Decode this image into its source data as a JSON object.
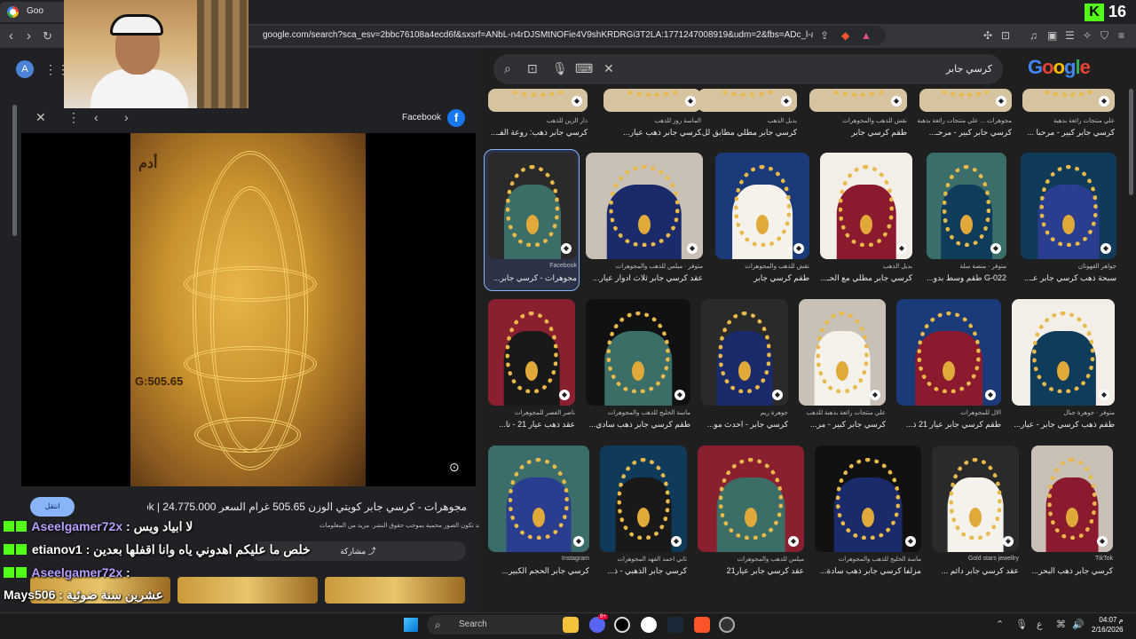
{
  "browser": {
    "tab_title": "Goo",
    "url": "google.com/search?sca_esv=2bbc76108a4ecd6f&sxsrf=ANbL-n4rDJSMtNOFie4V9shKRDRGi3T2LA:1771247008919&udm=2&fbs=ADc_l-aDyFhCabk...",
    "kick_count": "16",
    "kick_logo": "K"
  },
  "account": {
    "initial": "A"
  },
  "viewer": {
    "source_name": "Facebook",
    "image_overlay_text": "أدم",
    "image_overlay_weight": "G:505.65",
    "visit_label": "انتقل",
    "title": "مجوهرات - كرسي جابر كويتي الوزن 505.65 غرام السعر 24.775.000 | Facebook",
    "copyright_note": "قد تكون الصور محمية بموجب حقوق النشر. مزيد من المعلومات",
    "share_label": "مشاركة"
  },
  "chat": [
    {
      "user": "Aseelgamer72x",
      "message": "لا ابياد ويس"
    },
    {
      "user": "etianov1",
      "message": "خلص ما عليكم اهدوني ياه وانا اقفلها بعدين"
    },
    {
      "user": "Aseelgamer72x",
      "message": ""
    },
    {
      "user": "Mays506",
      "message": "عشرين سنة ضوئية"
    }
  ],
  "search": {
    "query": "كرسي جابر",
    "logo": "Google"
  },
  "results_top_row": [
    {
      "src": "دار الزين للذهب",
      "title": "كرسي جابر ذهب: روعة الفـ..."
    },
    {
      "src": "الماسة روز للذهب",
      "title": "كرسي جابر ذهب عيار..."
    },
    {
      "src": "بديل الذهب",
      "title": "كرسي جابر مطلي مطابق لل..."
    },
    {
      "src": "نقش للذهب والمجوهرات",
      "title": "طقم كرسي جابر"
    },
    {
      "src": "مجوهرات ... علي منتجات رائعة بذهبة",
      "title": "كرسي جابر كبير - مرحـ..."
    },
    {
      "src": "علي منتجات رائعة بذهبة",
      "title": "كرسي جابر كبير - مرحبا ..."
    }
  ],
  "results_row2": [
    {
      "src": "Facebook",
      "title": "مجوهرات - كرسي جابر..."
    },
    {
      "src": "متوفر · ميلس للذهب والمجوهرات",
      "title": "عقد كرسي جابر ثلاث ادوار عيار..."
    },
    {
      "src": "نقش للذهب والمجوهرات",
      "title": "طقم كرسي جابر"
    },
    {
      "src": "بديل الذهب",
      "title": "كرسي جابر مطلي مع الحـ..."
    },
    {
      "src": "متوفر · منصة سلة",
      "title": "G-022 طقم وسط بدو..."
    },
    {
      "src": "جواهر القهوتان",
      "title": "سبحة ذهب كرسي جابر عـ..."
    }
  ],
  "results_row3": [
    {
      "src": "ناصر الفصر للمجوهرات",
      "title": "عقد ذهب عيار 21 - تا..."
    },
    {
      "src": "ماسة الخليج للذهب والمجوهرات",
      "title": "طقم كرسي جابر ذهب سادي..."
    },
    {
      "src": "جوهرة ريم",
      "title": "كرسي جابر - احدث مو..."
    },
    {
      "src": "علي منتجات رائعة بذهبة للذهب",
      "title": "كرسي جابر كبير - مر..."
    },
    {
      "src": "الال للمجوهرات",
      "title": "طقم كرسي جابر عيار 21 ذ..."
    },
    {
      "src": "متوفر · جوهرة جبال",
      "title": "طقم ذهب كرسي جابر - عيار..."
    }
  ],
  "results_row4": [
    {
      "src": "Instagram",
      "title": "كرسي جابر الحجم الكبير..."
    },
    {
      "src": "ثاني احمد الفهد المجوهرات",
      "title": "كرسي جابر الذهبي - ذ..."
    },
    {
      "src": "ميلس للذهب والمجوهرات",
      "title": "عقد كرسي جابر عيار21"
    },
    {
      "src": "ماسة الخليج للذهب والمجوهرات",
      "title": "مزلفا كرسي جابر ذهب سادة..."
    },
    {
      "src": "Gold stars jewellry",
      "title": "عقد كرسي جابر دائم ..."
    },
    {
      "src": "TikTok",
      "title": "كرسي جابر ذهب البحر..."
    }
  ],
  "taskbar": {
    "search_label": "Search",
    "time": "04:07 م",
    "date": "2/16/2026",
    "notification_badge": "9+"
  }
}
